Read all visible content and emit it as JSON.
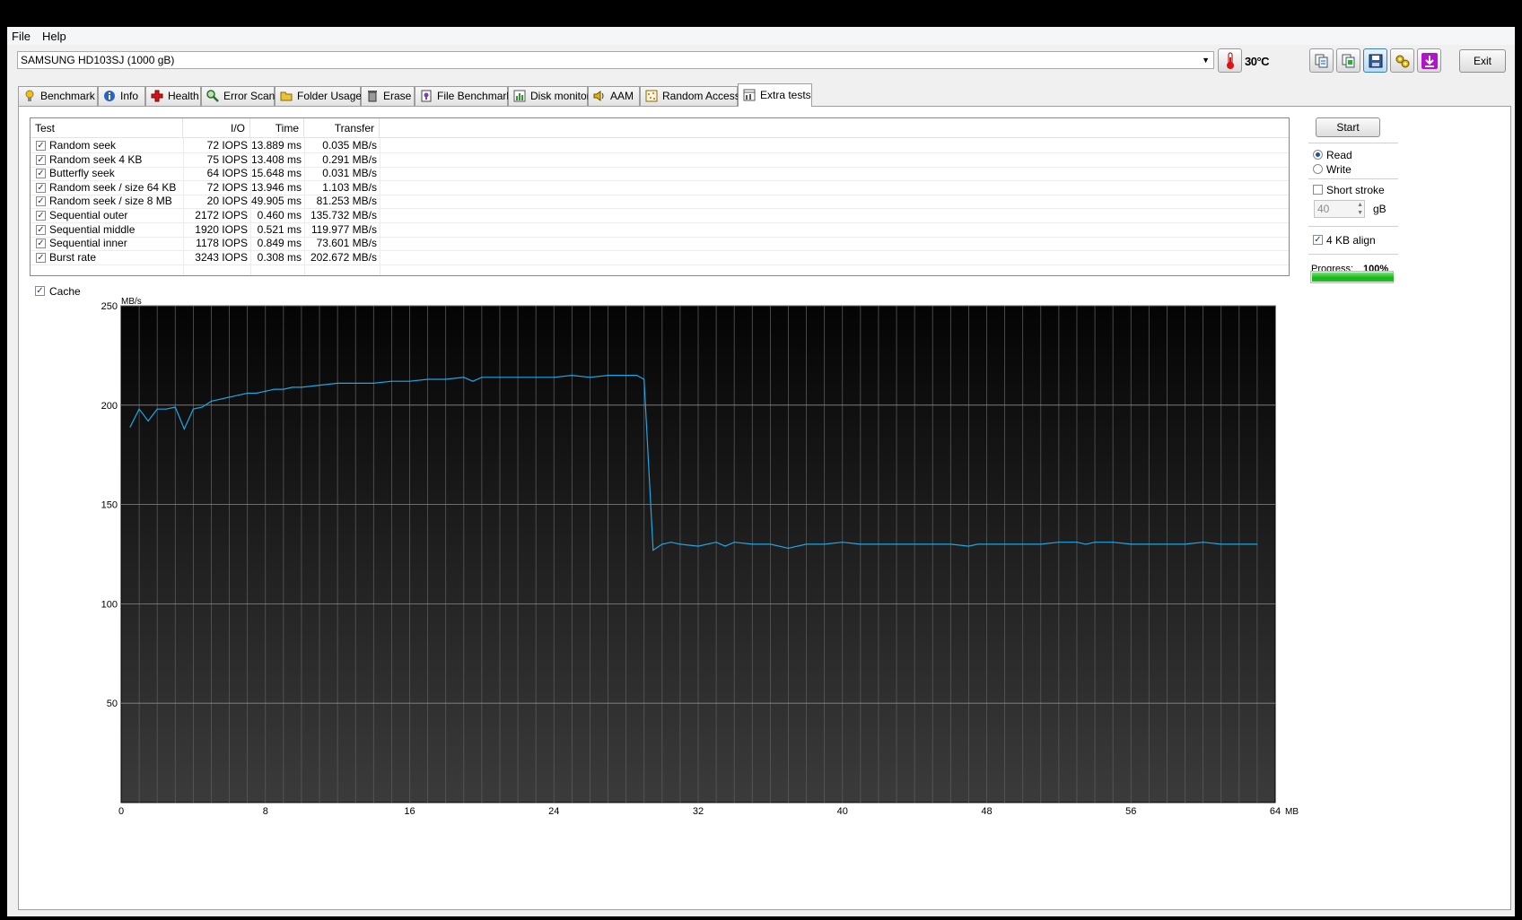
{
  "menu": {
    "file": "File",
    "help": "Help"
  },
  "drive": {
    "name": "SAMSUNG HD103SJ (1000 gB)"
  },
  "temperature": "30°C",
  "exit_label": "Exit",
  "tabs": [
    {
      "label": "Benchmark",
      "icon": "lightbulb-icon"
    },
    {
      "label": "Info",
      "icon": "info-icon"
    },
    {
      "label": "Health",
      "icon": "health-cross-icon"
    },
    {
      "label": "Error Scan",
      "icon": "magnifier-icon"
    },
    {
      "label": "Folder Usage",
      "icon": "folder-icon"
    },
    {
      "label": "Erase",
      "icon": "trash-icon"
    },
    {
      "label": "File Benchmark",
      "icon": "file-benchmark-icon"
    },
    {
      "label": "Disk monitor",
      "icon": "disk-monitor-icon"
    },
    {
      "label": "AAM",
      "icon": "speaker-icon"
    },
    {
      "label": "Random Access",
      "icon": "random-access-icon"
    },
    {
      "label": "Extra tests",
      "icon": "extra-tests-icon"
    }
  ],
  "results": {
    "columns": [
      "Test",
      "I/O",
      "Time",
      "Transfer"
    ],
    "rows": [
      {
        "test": "Random seek",
        "io": "72 IOPS",
        "time": "13.889 ms",
        "transfer": "0.035 MB/s"
      },
      {
        "test": "Random seek 4 KB",
        "io": "75 IOPS",
        "time": "13.408 ms",
        "transfer": "0.291 MB/s"
      },
      {
        "test": "Butterfly seek",
        "io": "64 IOPS",
        "time": "15.648 ms",
        "transfer": "0.031 MB/s"
      },
      {
        "test": "Random seek / size 64 KB",
        "io": "72 IOPS",
        "time": "13.946 ms",
        "transfer": "1.103 MB/s"
      },
      {
        "test": "Random seek / size 8 MB",
        "io": "20 IOPS",
        "time": "49.905 ms",
        "transfer": "81.253 MB/s"
      },
      {
        "test": "Sequential outer",
        "io": "2172 IOPS",
        "time": "0.460 ms",
        "transfer": "135.732 MB/s"
      },
      {
        "test": "Sequential middle",
        "io": "1920 IOPS",
        "time": "0.521 ms",
        "transfer": "119.977 MB/s"
      },
      {
        "test": "Sequential inner",
        "io": "1178 IOPS",
        "time": "0.849 ms",
        "transfer": "73.601 MB/s"
      },
      {
        "test": "Burst rate",
        "io": "3243 IOPS",
        "time": "0.308 ms",
        "transfer": "202.672 MB/s"
      }
    ]
  },
  "controls": {
    "start_label": "Start",
    "read_label": "Read",
    "write_label": "Write",
    "mode_selected": "Read",
    "short_stroke_label": "Short stroke",
    "short_stroke_checked": false,
    "stroke_value": "40",
    "stroke_unit": "gB",
    "align_label": "4 KB align",
    "align_checked": true,
    "progress_label": "Progress:",
    "progress_value": "100%",
    "progress_fraction": 1.0,
    "cache_label": "Cache",
    "cache_checked": true
  },
  "chart_data": {
    "type": "line",
    "ylabel": "MB/s",
    "xunit": "MB",
    "xlim": [
      0,
      64
    ],
    "ylim": [
      0,
      250
    ],
    "yticks": [
      50,
      100,
      150,
      200,
      250
    ],
    "xticks": [
      0,
      8,
      16,
      24,
      32,
      40,
      48,
      56,
      64
    ],
    "grid": true,
    "line_color": "#1ea6e6",
    "series": [
      {
        "x": [
          0.5,
          1.0,
          1.5,
          2.0,
          2.5,
          3.0,
          3.5,
          4.0,
          4.5,
          5.0,
          5.5,
          6.0,
          6.5,
          7.0,
          7.5,
          8.0,
          8.5,
          9.0,
          9.5,
          10.0,
          11.0,
          12.0,
          13.0,
          14.0,
          15.0,
          16.0,
          17.0,
          18.0,
          19.0,
          19.5,
          20.0,
          21.0,
          22.0,
          23.0,
          24.0,
          25.0,
          26.0,
          27.0,
          28.0,
          28.6,
          29.0,
          29.5,
          30.0,
          30.5,
          31.0,
          32.0,
          33.0,
          33.5,
          34.0,
          35.0,
          36.0,
          37.0,
          37.5,
          38.0,
          39.0,
          40.0,
          41.0,
          42.0,
          43.0,
          44.0,
          45.0,
          46.0,
          47.0,
          47.5,
          48.0,
          49.0,
          50.0,
          51.0,
          52.0,
          53.0,
          53.5,
          54.0,
          55.0,
          56.0,
          57.0,
          58.0,
          59.0,
          60.0,
          61.0,
          62.0,
          63.0
        ],
        "y": [
          189,
          198,
          192,
          198,
          198,
          199,
          188,
          198,
          199,
          202,
          203,
          204,
          205,
          206,
          206,
          207,
          208,
          208,
          209,
          209,
          210,
          211,
          211,
          211,
          212,
          212,
          213,
          213,
          214,
          212,
          214,
          214,
          214,
          214,
          214,
          215,
          214,
          215,
          215,
          215,
          213,
          127,
          130,
          131,
          130,
          129,
          131,
          129,
          131,
          130,
          130,
          128,
          129,
          130,
          130,
          131,
          130,
          130,
          130,
          130,
          130,
          130,
          129,
          130,
          130,
          130,
          130,
          130,
          131,
          131,
          130,
          131,
          131,
          130,
          130,
          130,
          130,
          131,
          130,
          130,
          130
        ]
      }
    ]
  }
}
